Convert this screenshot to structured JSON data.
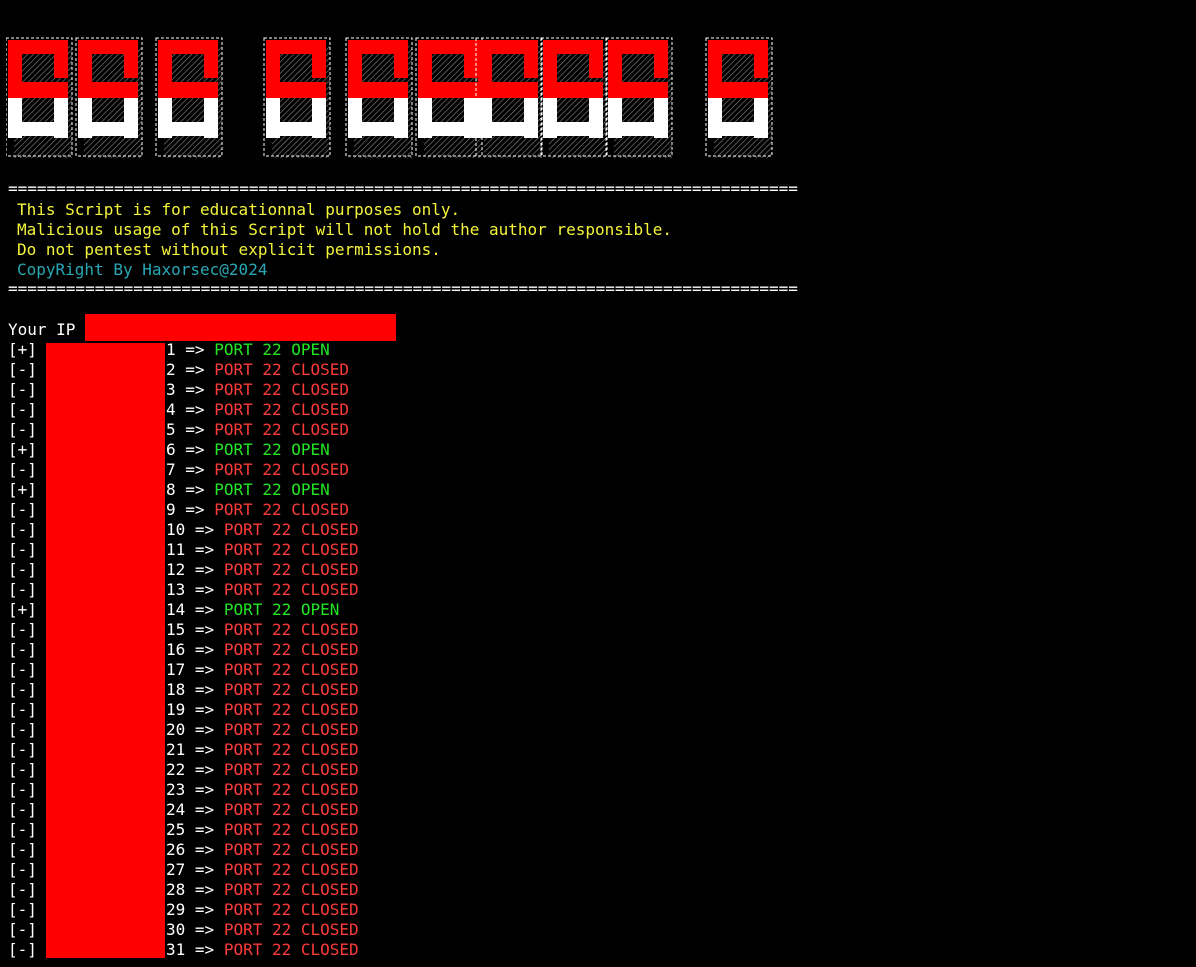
{
  "banner": {
    "text": "SSH RANGE IP",
    "top_color": "#ff0000",
    "bottom_color": "#ffffff"
  },
  "separator": "==================================================================================",
  "disclaimer": [
    "This Script is for educationnal purposes only.",
    "Malicious usage of this Script will not hold the author responsible.",
    "Do not pentest without explicit permissions."
  ],
  "copyright": "CopyRight By Haxorsec@2024",
  "your_ip_label": "Your IP",
  "arrow": "=>",
  "results": [
    {
      "mark": "[+]",
      "n": "1",
      "status": "PORT 22 OPEN",
      "open": true
    },
    {
      "mark": "[-]",
      "n": "2",
      "status": "PORT 22 CLOSED",
      "open": false
    },
    {
      "mark": "[-]",
      "n": "3",
      "status": "PORT 22 CLOSED",
      "open": false
    },
    {
      "mark": "[-]",
      "n": "4",
      "status": "PORT 22 CLOSED",
      "open": false
    },
    {
      "mark": "[-]",
      "n": "5",
      "status": "PORT 22 CLOSED",
      "open": false
    },
    {
      "mark": "[+]",
      "n": "6",
      "status": "PORT 22 OPEN",
      "open": true
    },
    {
      "mark": "[-]",
      "n": "7",
      "status": "PORT 22 CLOSED",
      "open": false
    },
    {
      "mark": "[+]",
      "n": "8",
      "status": "PORT 22 OPEN",
      "open": true
    },
    {
      "mark": "[-]",
      "n": "9",
      "status": "PORT 22 CLOSED",
      "open": false
    },
    {
      "mark": "[-]",
      "n": "10",
      "status": "PORT 22 CLOSED",
      "open": false
    },
    {
      "mark": "[-]",
      "n": "11",
      "status": "PORT 22 CLOSED",
      "open": false
    },
    {
      "mark": "[-]",
      "n": "12",
      "status": "PORT 22 CLOSED",
      "open": false
    },
    {
      "mark": "[-]",
      "n": "13",
      "status": "PORT 22 CLOSED",
      "open": false
    },
    {
      "mark": "[+]",
      "n": "14",
      "status": "PORT 22 OPEN",
      "open": true
    },
    {
      "mark": "[-]",
      "n": "15",
      "status": "PORT 22 CLOSED",
      "open": false
    },
    {
      "mark": "[-]",
      "n": "16",
      "status": "PORT 22 CLOSED",
      "open": false
    },
    {
      "mark": "[-]",
      "n": "17",
      "status": "PORT 22 CLOSED",
      "open": false
    },
    {
      "mark": "[-]",
      "n": "18",
      "status": "PORT 22 CLOSED",
      "open": false
    },
    {
      "mark": "[-]",
      "n": "19",
      "status": "PORT 22 CLOSED",
      "open": false
    },
    {
      "mark": "[-]",
      "n": "20",
      "status": "PORT 22 CLOSED",
      "open": false
    },
    {
      "mark": "[-]",
      "n": "21",
      "status": "PORT 22 CLOSED",
      "open": false
    },
    {
      "mark": "[-]",
      "n": "22",
      "status": "PORT 22 CLOSED",
      "open": false
    },
    {
      "mark": "[-]",
      "n": "23",
      "status": "PORT 22 CLOSED",
      "open": false
    },
    {
      "mark": "[-]",
      "n": "24",
      "status": "PORT 22 CLOSED",
      "open": false
    },
    {
      "mark": "[-]",
      "n": "25",
      "status": "PORT 22 CLOSED",
      "open": false
    },
    {
      "mark": "[-]",
      "n": "26",
      "status": "PORT 22 CLOSED",
      "open": false
    },
    {
      "mark": "[-]",
      "n": "27",
      "status": "PORT 22 CLOSED",
      "open": false
    },
    {
      "mark": "[-]",
      "n": "28",
      "status": "PORT 22 CLOSED",
      "open": false
    },
    {
      "mark": "[-]",
      "n": "29",
      "status": "PORT 22 CLOSED",
      "open": false
    },
    {
      "mark": "[-]",
      "n": "30",
      "status": "PORT 22 CLOSED",
      "open": false
    },
    {
      "mark": "[-]",
      "n": "31",
      "status": "PORT 22 CLOSED",
      "open": false
    }
  ]
}
